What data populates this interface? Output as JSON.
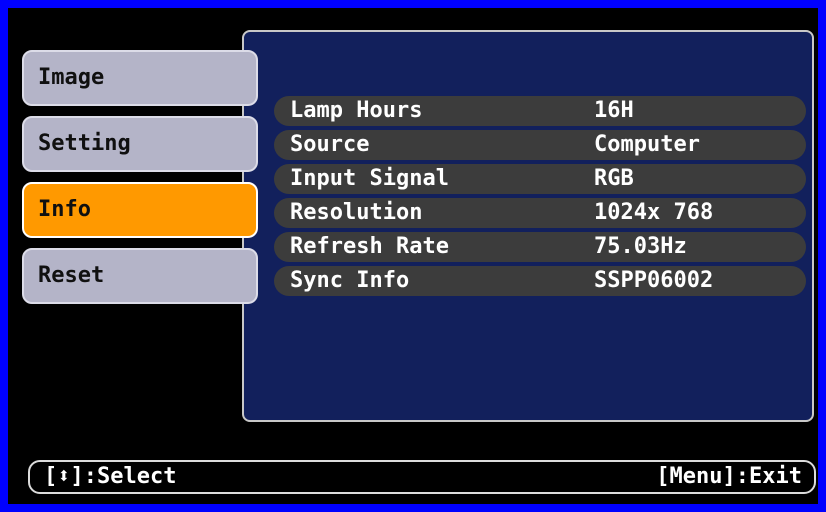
{
  "menu": {
    "tabs": [
      {
        "label": "Image"
      },
      {
        "label": "Setting"
      },
      {
        "label": "Info"
      },
      {
        "label": "Reset"
      }
    ],
    "active_tab": "Info"
  },
  "info": {
    "rows": [
      {
        "label": "Lamp Hours",
        "value": "16H"
      },
      {
        "label": "Source",
        "value": "Computer"
      },
      {
        "label": "Input Signal",
        "value": "RGB"
      },
      {
        "label": "Resolution",
        "value": "1024x 768"
      },
      {
        "label": "Refresh Rate",
        "value": "75.03Hz"
      },
      {
        "label": "Sync Info",
        "value": "SSPP06002"
      }
    ]
  },
  "status_bar": {
    "select_text": "[⬍]:Select",
    "exit_text": "[Menu]:Exit"
  },
  "colors": {
    "outer_background": "#0000FF",
    "frame": "#000000",
    "panel": "#12205C",
    "tab_inactive": "#B4B4C8",
    "tab_active": "#FF9900",
    "row_background": "#3C3C3C",
    "text": "#FFFFFF"
  }
}
